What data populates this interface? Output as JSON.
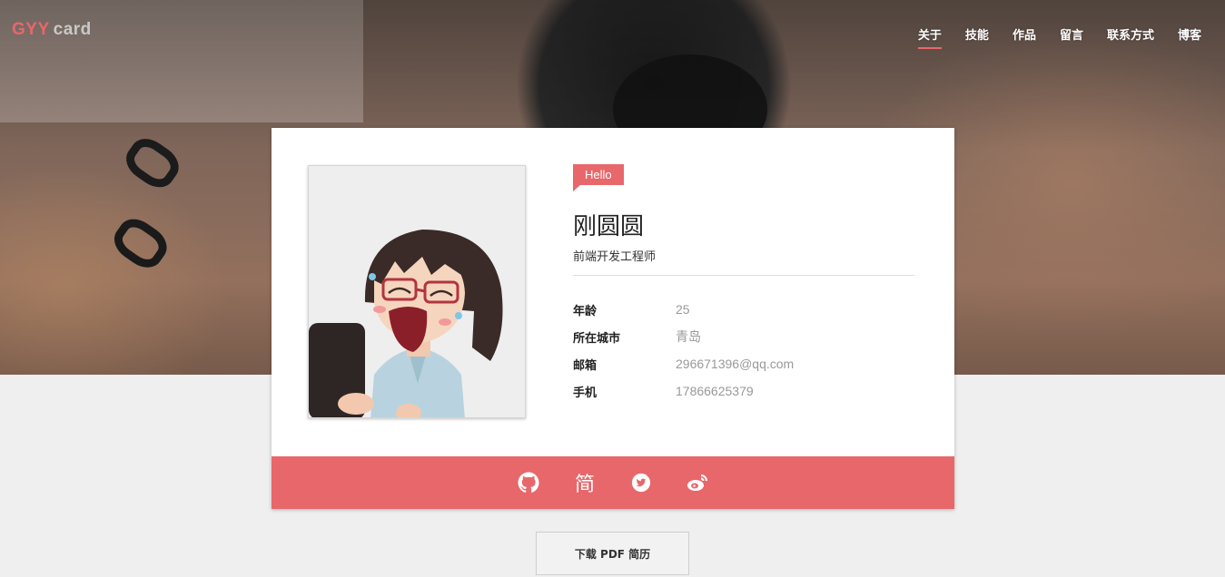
{
  "brand": {
    "part1": "GYY",
    "part2": "card"
  },
  "nav": {
    "items": [
      {
        "label": "关于",
        "active": true
      },
      {
        "label": "技能"
      },
      {
        "label": "作品"
      },
      {
        "label": "留言"
      },
      {
        "label": "联系方式"
      },
      {
        "label": "博客"
      }
    ]
  },
  "profile": {
    "greeting": "Hello",
    "name": "刚圆圆",
    "title": "前端开发工程师",
    "info": [
      {
        "label": "年龄",
        "value": "25"
      },
      {
        "label": "所在城市",
        "value": "青岛"
      },
      {
        "label": "邮箱",
        "value": "296671396@qq.com"
      },
      {
        "label": "手机",
        "value": "17866625379"
      }
    ]
  },
  "social": {
    "icons": [
      "github-icon",
      "jianshu-icon",
      "twitter-icon",
      "weibo-icon"
    ],
    "jianshu_glyph": "简"
  },
  "download": {
    "label": "下载 PDF 简历"
  },
  "colors": {
    "accent": "#e8676b",
    "background": "#efefef"
  }
}
